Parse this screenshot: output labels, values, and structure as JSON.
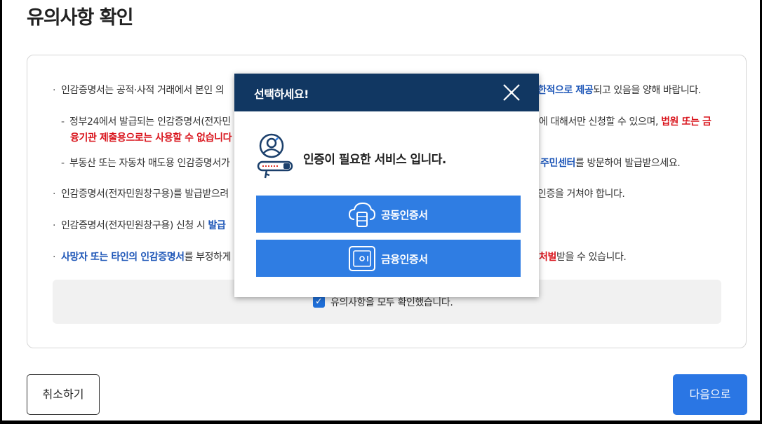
{
  "page": {
    "title": "유의사항 확인"
  },
  "notices": [
    {
      "pre": "인감증명서는 공적·사적 거래에서 본인 의",
      "hl": "한적으로 제공",
      "post": "되고 있음을 양해 바랍니다."
    },
    {
      "pre": "정부24에서 발급되는 인감증명서(전자민",
      "mid": "에 대해서만 신청할 수 있으며,",
      "red": "법원 또는 금",
      "line2": "융기관 제출용으로는 사용할 수 없습니다"
    },
    {
      "pre": "부동산 또는 자동차 매도용 인감증명서가",
      "hl": "주민센터",
      "post": "를 방문하여 발급받으세요."
    },
    {
      "pre": "인감증명서(전자민원창구용)를 발급받으려",
      "post": "인증을 거쳐야 합니다."
    },
    {
      "pre": "인감증명서(전자민원창구용) 신청 시",
      "hl": "발급"
    },
    {
      "hl": "사망자 또는 타인의 인감증명서",
      "pre": "를 부정하게",
      "red": "처벌",
      "post": "받을 수 있습니다."
    }
  ],
  "agree": {
    "checked": true,
    "label": "유의사항을 모두 확인했습니다."
  },
  "buttons": {
    "cancel": "취소하기",
    "next": "다음으로"
  },
  "modal": {
    "title": "선택하세요!",
    "message": "인증이 필요한 서비스 입니다.",
    "options": [
      {
        "label": "공동인증서",
        "icon": "cloud-server-icon"
      },
      {
        "label": "금융인증서",
        "icon": "safe-icon"
      }
    ]
  },
  "colors": {
    "header": "#113762",
    "button": "#2f7de3",
    "next_button": "#2a76e4",
    "highlight_blue": "#1f57b8",
    "highlight_red": "#d9141c"
  }
}
